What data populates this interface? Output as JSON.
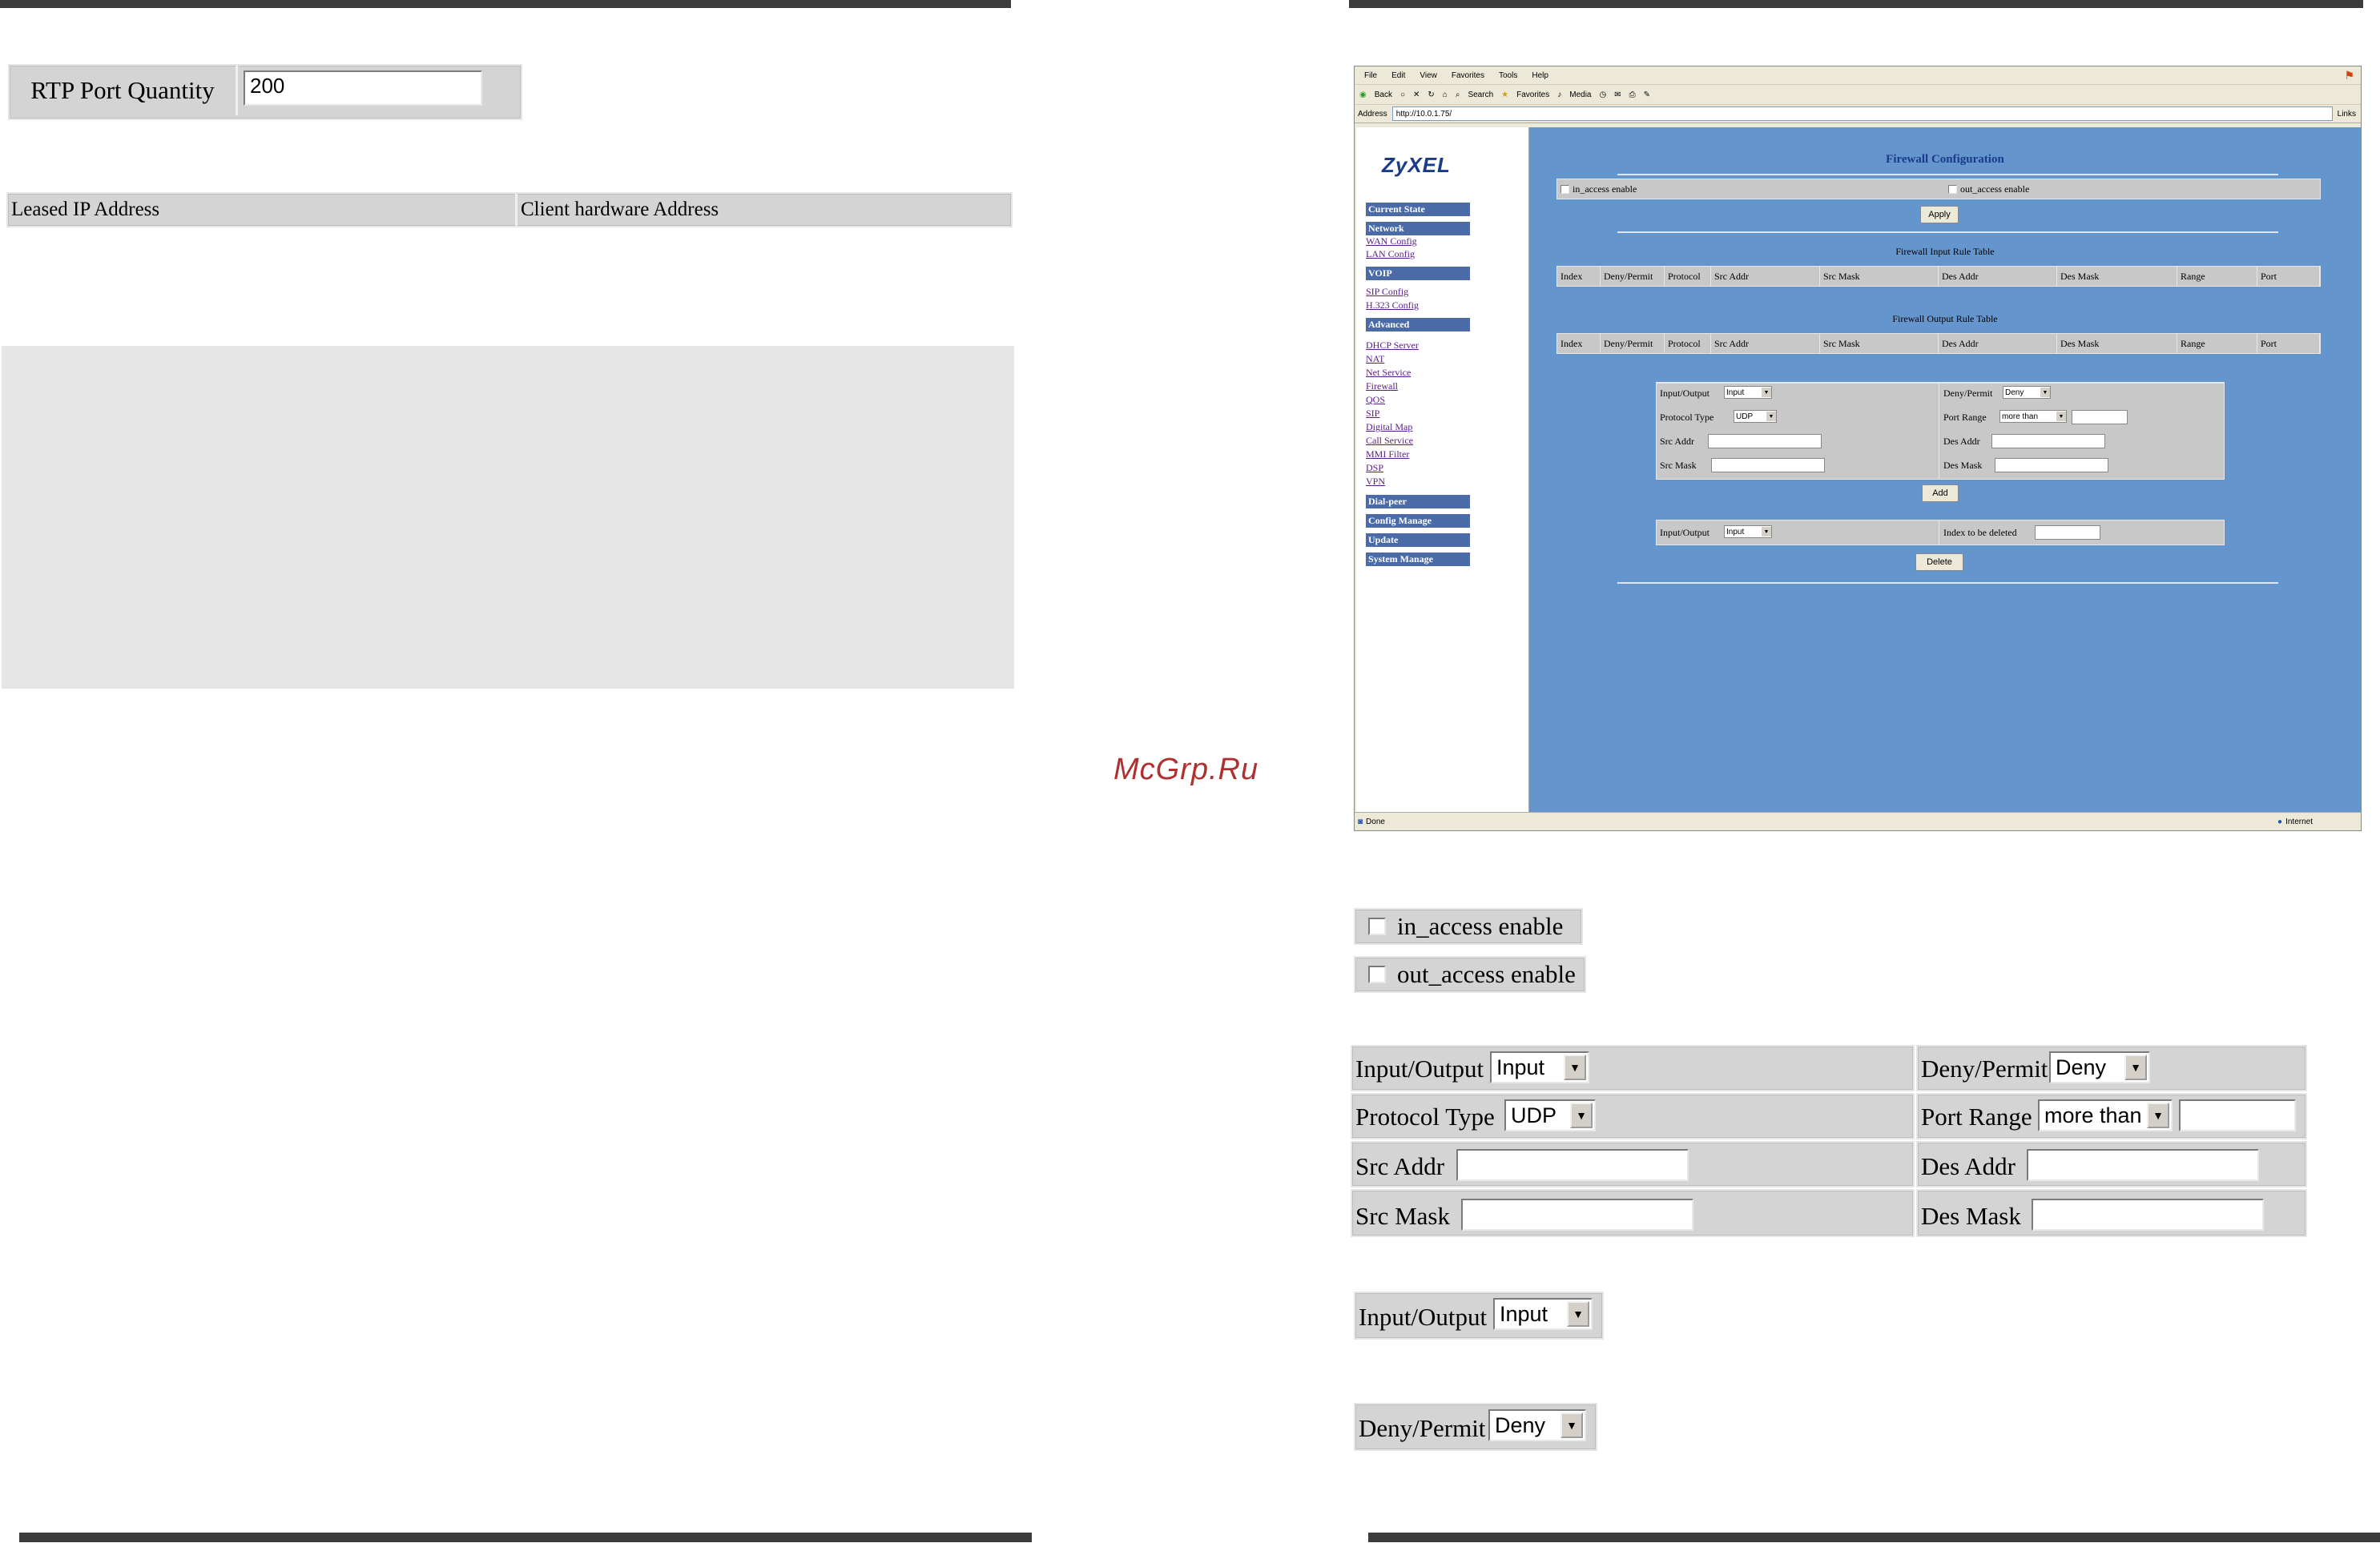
{
  "rtp": {
    "label": "RTP Port Quantity",
    "value": "200"
  },
  "dhcp_table": {
    "col1": "Leased IP Address",
    "col2": "Client hardware Address"
  },
  "watermark": "McGrp.Ru",
  "browser": {
    "menu": [
      "File",
      "Edit",
      "View",
      "Favorites",
      "Tools",
      "Help"
    ],
    "toolbar": [
      "Back",
      "Search",
      "Favorites",
      "Media"
    ],
    "address_label": "Address",
    "url": "http://10.0.1.75/",
    "links_label": "Links",
    "status": "Done",
    "zone": "Internet",
    "logo": "ZyXEL",
    "sidebar": [
      {
        "type": "head",
        "label": "Current State"
      },
      {
        "type": "head",
        "label": "Network"
      },
      {
        "type": "link",
        "label": "WAN Config"
      },
      {
        "type": "link",
        "label": "LAN Config"
      },
      {
        "type": "head",
        "label": "VOIP"
      },
      {
        "type": "link",
        "label": "SIP Config"
      },
      {
        "type": "link",
        "label": "H.323 Config"
      },
      {
        "type": "head",
        "label": "Advanced"
      },
      {
        "type": "link",
        "label": "DHCP Server"
      },
      {
        "type": "link",
        "label": "NAT"
      },
      {
        "type": "link",
        "label": "Net Service"
      },
      {
        "type": "link",
        "label": "Firewall"
      },
      {
        "type": "link",
        "label": "QOS"
      },
      {
        "type": "link",
        "label": "SIP"
      },
      {
        "type": "link",
        "label": "Digital Map"
      },
      {
        "type": "link",
        "label": "Call Service"
      },
      {
        "type": "link",
        "label": "MMI Filter"
      },
      {
        "type": "link",
        "label": "DSP"
      },
      {
        "type": "link",
        "label": "VPN"
      },
      {
        "type": "head",
        "label": "Dial-peer"
      },
      {
        "type": "head",
        "label": "Config Manage"
      },
      {
        "type": "head",
        "label": "Update"
      },
      {
        "type": "head",
        "label": "System Manage"
      }
    ],
    "firewall": {
      "title": "Firewall Configuration",
      "in_access": "in_access enable",
      "out_access": "out_access enable",
      "apply": "Apply",
      "input_table_title": "Firewall Input Rule Table",
      "output_table_title": "Firewall Output Rule Table",
      "columns": [
        "Index",
        "Deny/Permit",
        "Protocol",
        "Src Addr",
        "Src Mask",
        "Des Addr",
        "Des Mask",
        "Range",
        "Port"
      ],
      "input_output": "Input/Output",
      "input_val": "Input",
      "deny_permit": "Deny/Permit",
      "deny_val": "Deny",
      "protocol_type": "Protocol Type",
      "udp_val": "UDP",
      "port_range": "Port Range",
      "more_than_val": "more than",
      "src_addr": "Src Addr",
      "des_addr": "Des Addr",
      "src_mask": "Src Mask",
      "des_mask": "Des Mask",
      "add": "Add",
      "index_delete": "Index to be deleted",
      "delete": "Delete"
    }
  },
  "zoom": {
    "in_access": "in_access enable",
    "out_access": "out_access enable",
    "input_output": "Input/Output",
    "input_val": "Input",
    "deny_permit": "Deny/Permit",
    "deny_val": "Deny",
    "protocol_type": "Protocol Type",
    "udp_val": "UDP",
    "port_range": "Port Range",
    "more_than_val": "more than",
    "src_addr": "Src Addr",
    "des_addr": "Des Addr",
    "src_mask": "Src Mask",
    "des_mask": "Des Mask"
  }
}
